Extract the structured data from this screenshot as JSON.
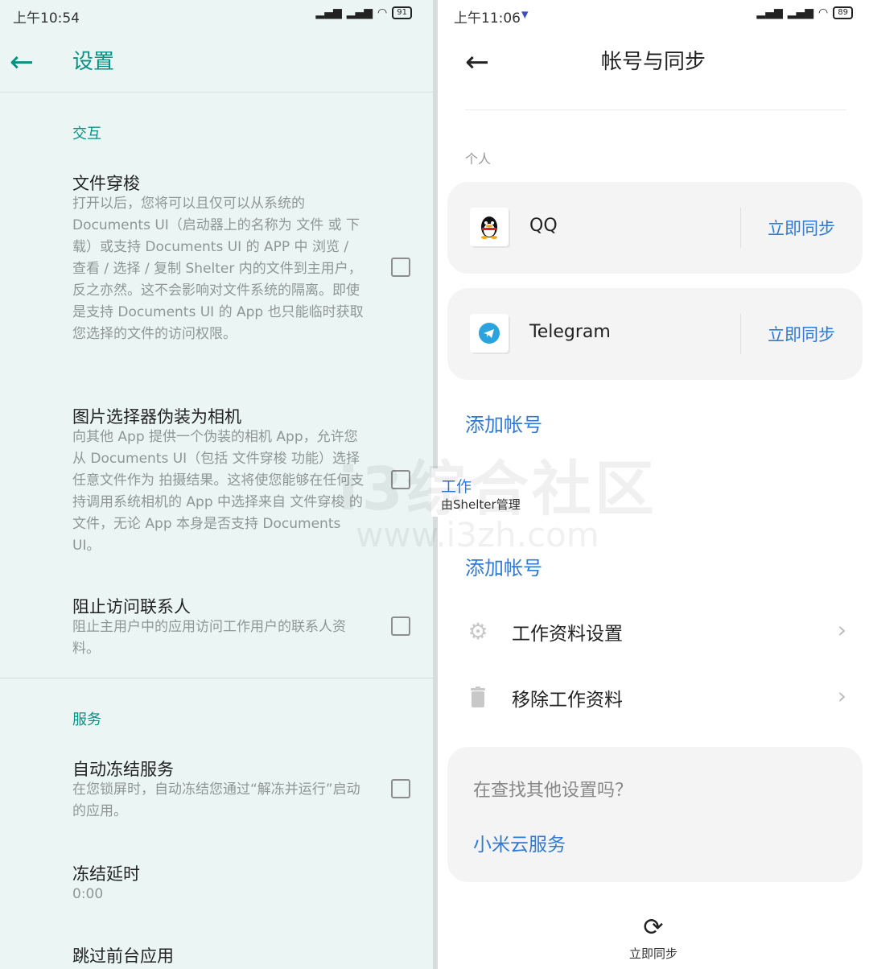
{
  "left": {
    "status_time": "上午10:54",
    "battery": "91",
    "title": "设置",
    "section_interaction": "交互",
    "items": [
      {
        "title": "文件穿梭",
        "desc": "打开以后，您将可以且仅可以从系统的 Documents UI（启动器上的名称为 文件 或 下载）或支持 Documents UI 的 APP 中 浏览 / 查看 / 选择 / 复制 Shelter 内的文件到主用户，反之亦然。这不会影响对文件系统的隔离。即使是支持 Documents UI 的 App 也只能临时获取您选择的文件的访问权限。"
      },
      {
        "title": "图片选择器伪装为相机",
        "desc": "向其他 App 提供一个伪装的相机 App，允许您从 Documents UI（包括 文件穿梭 功能）选择任意文件作为 拍摄结果。这将使您能够在任何支持调用系统相机的 App 中选择来自 文件穿梭 的文件，无论 App 本身是否支持 Documents UI。"
      },
      {
        "title": "阻止访问联系人",
        "desc": "阻止主用户中的应用访问工作用户的联系人资料。"
      }
    ],
    "section_service": "服务",
    "service_items": [
      {
        "title": "自动冻结服务",
        "desc": "在您锁屏时，自动冻结您通过“解冻并运行”启动的应用。"
      },
      {
        "title": "冻结延时",
        "desc": "0:00"
      },
      {
        "title": "跳过前台应用",
        "desc": ""
      }
    ]
  },
  "right": {
    "status_time": "上午11:06",
    "battery": "89",
    "title": "帐号与同步",
    "section_personal": "个人",
    "accounts": [
      {
        "name": "QQ",
        "action": "立即同步",
        "icon": "qq-icon"
      },
      {
        "name": "Telegram",
        "action": "立即同步",
        "icon": "telegram-icon"
      }
    ],
    "add_account": "添加帐号",
    "work_section": "工作",
    "work_sub": "由Shelter管理",
    "add_account_work": "添加帐号",
    "menu": [
      {
        "label": "工作资料设置",
        "icon": "gear-icon"
      },
      {
        "label": "移除工作资料",
        "icon": "trash-icon"
      }
    ],
    "more_title": "在查找其他设置吗？",
    "more_link": "小米云服务",
    "bottom_action": "立即同步"
  },
  "watermark": {
    "line1": "i3综合社区",
    "line2": "www.i3zh.com"
  },
  "colors": {
    "teal": "#0a8f83",
    "blue": "#2f7ad6",
    "left_bg": "#eaf5f4"
  }
}
